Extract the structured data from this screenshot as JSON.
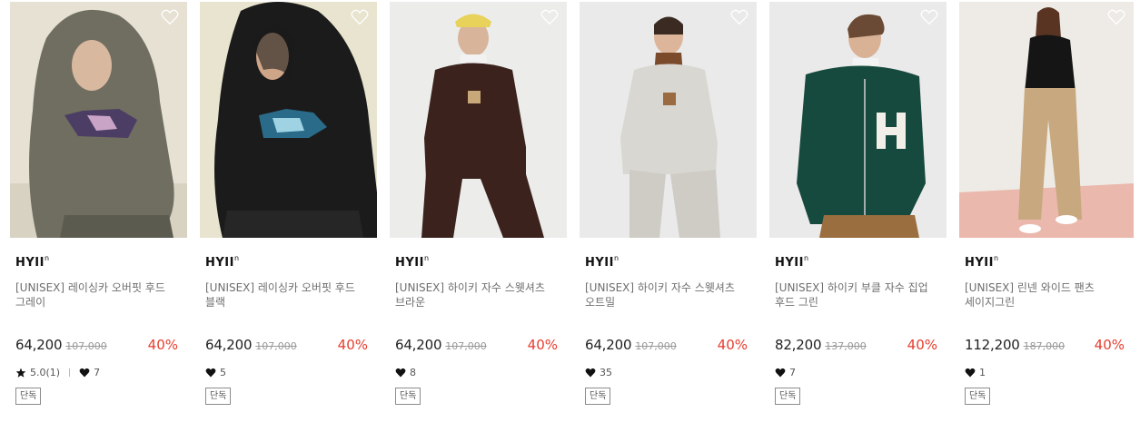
{
  "products": [
    {
      "brand": "HYII",
      "brand_sup": "n",
      "name": "[UNISEX] 레이싱카 오버핏 후드 그레이",
      "price": "64,200",
      "original_price": "107,000",
      "discount": "40%",
      "rating": "5.0(1)",
      "likes": "7",
      "tag": "단독"
    },
    {
      "brand": "HYII",
      "brand_sup": "n",
      "name": "[UNISEX] 레이싱카 오버핏 후드 블랙",
      "price": "64,200",
      "original_price": "107,000",
      "discount": "40%",
      "likes": "5",
      "tag": "단독"
    },
    {
      "brand": "HYII",
      "brand_sup": "n",
      "name": "[UNISEX] 하이키 자수 스웻셔츠 브라운",
      "price": "64,200",
      "original_price": "107,000",
      "discount": "40%",
      "likes": "8",
      "tag": "단독"
    },
    {
      "brand": "HYII",
      "brand_sup": "n",
      "name": "[UNISEX] 하이키 자수 스웻셔츠 오트밀",
      "price": "64,200",
      "original_price": "107,000",
      "discount": "40%",
      "likes": "35",
      "tag": "단독"
    },
    {
      "brand": "HYII",
      "brand_sup": "n",
      "name": "[UNISEX] 하이키 부클 자수 집업 후드 그린",
      "price": "82,200",
      "original_price": "137,000",
      "discount": "40%",
      "likes": "7",
      "tag": "단독"
    },
    {
      "brand": "HYII",
      "brand_sup": "n",
      "name": "[UNISEX] 린넨 와이드 팬츠 세이지그린",
      "price": "112,200",
      "original_price": "187,000",
      "discount": "40%",
      "likes": "1",
      "tag": "단독"
    }
  ],
  "colors": {
    "discount": "#e73d2f",
    "muted_text": "#6e6e6e",
    "strike_price": "#999999"
  },
  "icons": {
    "wishlist": "heart-outline-icon",
    "likes": "heart-filled-icon",
    "rating": "star-icon"
  }
}
